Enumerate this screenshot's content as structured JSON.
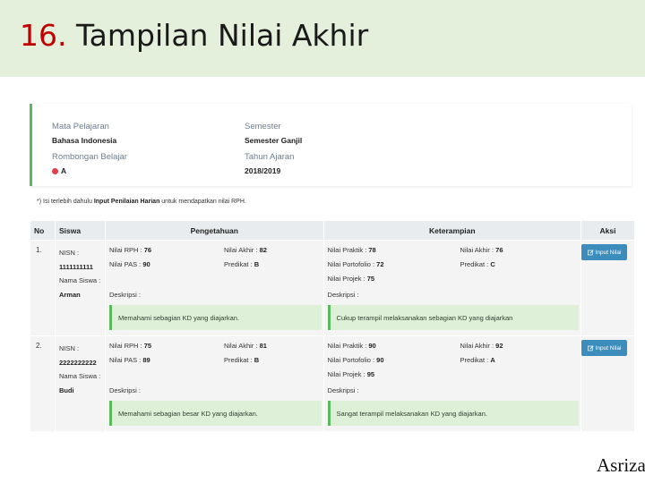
{
  "slide": {
    "number": "16.",
    "title": "Tampilan Nilai Akhir",
    "author": "Asriza"
  },
  "info": {
    "mapel_label": "Mata Pelajaran",
    "mapel_value": "Bahasa Indonesia",
    "semester_label": "Semester",
    "semester_value": "Semester Ganjil",
    "rombel_label": "Rombongan Belajar",
    "rombel_value": "A",
    "tahun_label": "Tahun Ajaran",
    "tahun_value": "2018/2019"
  },
  "note": {
    "prefix": "*) Isi terlebih dahulu ",
    "bold": "Input Penilaian Harian",
    "suffix": " untuk mendapatkan nilai RPH."
  },
  "table": {
    "headers": [
      "No",
      "Siswa",
      "Pengetahuan",
      "Keterampian",
      "Aksi"
    ],
    "button_label": "Input Nilai",
    "rows": [
      {
        "no": "1.",
        "nisn_label": "NISN :",
        "nisn": "1111111111",
        "nama_label": "Nama Siswa :",
        "nama": "Arman",
        "rph": "Nilai RPH : ",
        "rph_val": "76",
        "pas": "Nilai PAS : ",
        "pas_val": "90",
        "akhir_p": "Nilai Akhir : ",
        "akhir_p_val": "82",
        "predikat_p": "Predikat : ",
        "predikat_p_val": "B",
        "praktik": "Nilai Praktik : ",
        "praktik_val": "78",
        "portofolio": "Nilai Portofolio : ",
        "portofolio_val": "72",
        "projek": "Nilai Projek : ",
        "projek_val": "75",
        "akhir_k": "Nilai Akhir : ",
        "akhir_k_val": "76",
        "predikat_k": "Predikat : ",
        "predikat_k_val": "C",
        "deskripsi_label": "Deskripsi :",
        "deskripsi_p": "Memahami sebagian KD yang diajarkan.",
        "deskripsi_k": "Cukup terampil melaksanakan sebagian KD yang diajarkan"
      },
      {
        "no": "2.",
        "nisn_label": "NISN :",
        "nisn": "2222222222",
        "nama_label": "Nama Siswa :",
        "nama": "Budi",
        "rph": "Nilai RPH : ",
        "rph_val": "75",
        "pas": "Nilai PAS : ",
        "pas_val": "89",
        "akhir_p": "Nilai Akhir : ",
        "akhir_p_val": "81",
        "predikat_p": "Predikat : ",
        "predikat_p_val": "B",
        "praktik": "Nilai Praktik : ",
        "praktik_val": "90",
        "portofolio": "Nilai Portofolio : ",
        "portofolio_val": "90",
        "projek": "Nilai Projek : ",
        "projek_val": "95",
        "akhir_k": "Nilai Akhir : ",
        "akhir_k_val": "92",
        "predikat_k": "Predikat : ",
        "predikat_k_val": "A",
        "deskripsi_label": "Deskripsi :",
        "deskripsi_p": "Memahami sebagian besar KD yang diajarkan.",
        "deskripsi_k": "Sangat terampil melaksanakan KD yang diajarkan."
      }
    ]
  }
}
